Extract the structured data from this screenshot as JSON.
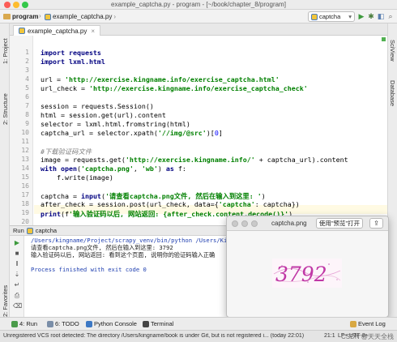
{
  "window": {
    "title": "example_captcha.py - program - [~/book/chapter_8/program]"
  },
  "navbar": {
    "project_crumb": "program",
    "file_crumb": "example_captcha.py",
    "run_config": "captcha"
  },
  "left_strip": {
    "project": "1: Project",
    "structure": "2: Structure",
    "favorites": "2: Favorites"
  },
  "right_strip": {
    "sciview": "SciView",
    "database": "Database"
  },
  "editor": {
    "tab": "example_captcha.py",
    "line_numbers": [
      "1",
      "2",
      "3",
      "4",
      "5",
      "6",
      "7",
      "8",
      "9",
      "10",
      "11",
      "12",
      "13",
      "14",
      "15",
      "16",
      "17",
      "18",
      "19",
      "20",
      "21"
    ],
    "code": [
      "import requests",
      "import lxml.html",
      "",
      "url = 'http://exercise.kingname.info/exercise_captcha.html'",
      "url_check = 'http://exercise.kingname.info/exercise_captcha_check'",
      "",
      "session = requests.Session()",
      "html = session.get(url).content",
      "selector = lxml.html.fromstring(html)",
      "captcha_url = selector.xpath('//img/@src')[0]",
      "",
      "#下载验证码文件",
      "image = requests.get('http://exercise.kingname.info/' + captcha_url).content",
      "with open('captcha.png', 'wb') as f:",
      "    f.write(image)",
      "",
      "captcha = input('请查看captcha.png文件, 然后在输入到这里: ')",
      "after_check = session.post(url_check, data={'captcha': captcha})",
      "",
      "print(f'输入验证码以后, 网站返回: {after_check.content.decode()}')",
      ""
    ]
  },
  "run_panel": {
    "title": "Run",
    "config": "captcha",
    "console": [
      "/Users/kingname/Project/scrapy_venv/bin/python /Users/Ki",
      "请查看captcha.png文件, 然后在输入到这里: 3792",
      "输入验证码以后, 网站返回: 看到这个页面, 说明你的验证码输入正确",
      "",
      "Process finished with exit code 0"
    ]
  },
  "image_window": {
    "title": "captcha.png",
    "open_button": "使用\"预览\"打开",
    "captcha_text": "3792"
  },
  "bottom_tools": {
    "run": "4: Run",
    "todo": "6: TODO",
    "python_console": "Python Console",
    "terminal": "Terminal",
    "event_log": "Event Log"
  },
  "status": {
    "message": "Unregistered VCS root detected: The directory /Users/kingname/book is under Git, but is not registered i... (today 22:01)",
    "position": "21:1",
    "encoding": "LF÷ UTF-8÷",
    "watermark": "CSDN @天天全栈"
  }
}
